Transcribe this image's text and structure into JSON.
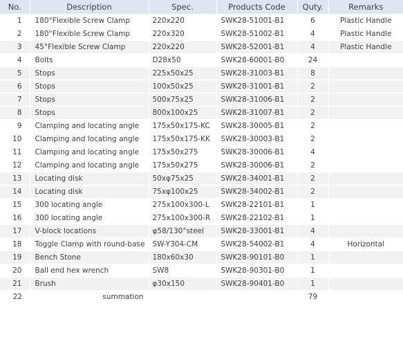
{
  "table": {
    "name": "bill-of-materials",
    "columns": [
      {
        "key": "no",
        "label": "No."
      },
      {
        "key": "desc",
        "label": "Description"
      },
      {
        "key": "spec",
        "label": "Spec."
      },
      {
        "key": "code",
        "label": "Products Code"
      },
      {
        "key": "qty",
        "label": "Quty."
      },
      {
        "key": "remarks",
        "label": "Remarks"
      }
    ],
    "rows": [
      {
        "no": "1",
        "desc": "180°Flexible Screw Clamp",
        "spec": "220x220",
        "code": "SWK28-51001-B1",
        "qty": "6",
        "remarks": "Plastic Handle",
        "shaded": false
      },
      {
        "no": "2",
        "desc": "180°Flexible Screw Clamp",
        "spec": "220x320",
        "code": "SWK28-51002-B1",
        "qty": "4",
        "remarks": "Plastic Handle",
        "shaded": false
      },
      {
        "no": "3",
        "desc": "45°Flexible Screw Clamp",
        "spec": "220x220",
        "code": "SWK28-52001-B1",
        "qty": "4",
        "remarks": "Plastic Handle",
        "shaded": true
      },
      {
        "no": "4",
        "desc": "Bolts",
        "spec": "D28x50",
        "code": "SWK28-60001-B0",
        "qty": "24",
        "remarks": "",
        "shaded": false
      },
      {
        "no": "5",
        "desc": "Stops",
        "spec": "225x50x25",
        "code": "SWK28-31003-B1",
        "qty": "8",
        "remarks": "",
        "shaded": true
      },
      {
        "no": "6",
        "desc": "Stops",
        "spec": "100x50x25",
        "code": "SWK28-31001-B1",
        "qty": "2",
        "remarks": "",
        "shaded": true
      },
      {
        "no": "7",
        "desc": "Stops",
        "spec": "500x75x25",
        "code": "SWK28-31006-B1",
        "qty": "2",
        "remarks": "",
        "shaded": true
      },
      {
        "no": "8",
        "desc": "Stops",
        "spec": "800x100x25",
        "code": "SWK28-31007-B1",
        "qty": "2",
        "remarks": "",
        "shaded": true
      },
      {
        "no": "9",
        "desc": "Clamping and locating angle",
        "spec": "175x50x175-KC",
        "code": "SWK28-30005-B1",
        "qty": "2",
        "remarks": "",
        "shaded": false
      },
      {
        "no": "10",
        "desc": "Clamping and locating angle",
        "spec": "175x50x175-KK",
        "code": "SWK28-30003-B1",
        "qty": "2",
        "remarks": "",
        "shaded": false
      },
      {
        "no": "11",
        "desc": "Clamping and locating angle",
        "spec": "175x50x275",
        "code": "SWK28-30006-B1",
        "qty": "4",
        "remarks": "",
        "shaded": false
      },
      {
        "no": "12",
        "desc": "Clamping and locating angle",
        "spec": "175x50x275",
        "code": "SWK28-30006-B1",
        "qty": "2",
        "remarks": "",
        "shaded": false
      },
      {
        "no": "13",
        "desc": "Locating disk",
        "spec": "50xφ75x25",
        "code": "SWK28-34001-B1",
        "qty": "2",
        "remarks": "",
        "shaded": true
      },
      {
        "no": "14",
        "desc": "Locating disk",
        "spec": "75xφ100x25",
        "code": "SWK28-34002-B1",
        "qty": "2",
        "remarks": "",
        "shaded": true
      },
      {
        "no": "15",
        "desc": "300 locating angle",
        "spec": "275x100x300-L",
        "code": "SWK28-22101-B1",
        "qty": "1",
        "remarks": "",
        "shaded": false
      },
      {
        "no": "16",
        "desc": "300 locating angle",
        "spec": "275x100x300-R",
        "code": "SWK28-22102-B1",
        "qty": "1",
        "remarks": "",
        "shaded": false
      },
      {
        "no": "17",
        "desc": "V-block locations",
        "spec": "φ58/130°steel",
        "code": "SWK28-33001-B1",
        "qty": "4",
        "remarks": "",
        "shaded": true
      },
      {
        "no": "18",
        "desc": "Toggle Clamp with round-base",
        "spec": "SW-Y304-CM",
        "code": "SWK28-54002-B1",
        "qty": "4",
        "remarks": "Horizontal",
        "shaded": false
      },
      {
        "no": "19",
        "desc": "Bench Stone",
        "spec": "180x60x30",
        "code": "SWK28-90101-B0",
        "qty": "1",
        "remarks": "",
        "shaded": true
      },
      {
        "no": "20",
        "desc": "Ball end hex wrench",
        "spec": "SW8",
        "code": "SWK28-90301-B0",
        "qty": "1",
        "remarks": "",
        "shaded": false
      },
      {
        "no": "21",
        "desc": "Brush",
        "spec": "φ30x150",
        "code": "SWK28-90401-B0",
        "qty": "1",
        "remarks": "",
        "shaded": true
      }
    ],
    "total_row": {
      "no": "22",
      "label": "summation",
      "qty": "79"
    }
  },
  "colors": {
    "header_background": "#dce6f1",
    "row_shaded_background": "#f2f2f2",
    "row_plain_background": "#ffffff",
    "text": "#3f3f3f",
    "grid_line": "#ffffff"
  }
}
